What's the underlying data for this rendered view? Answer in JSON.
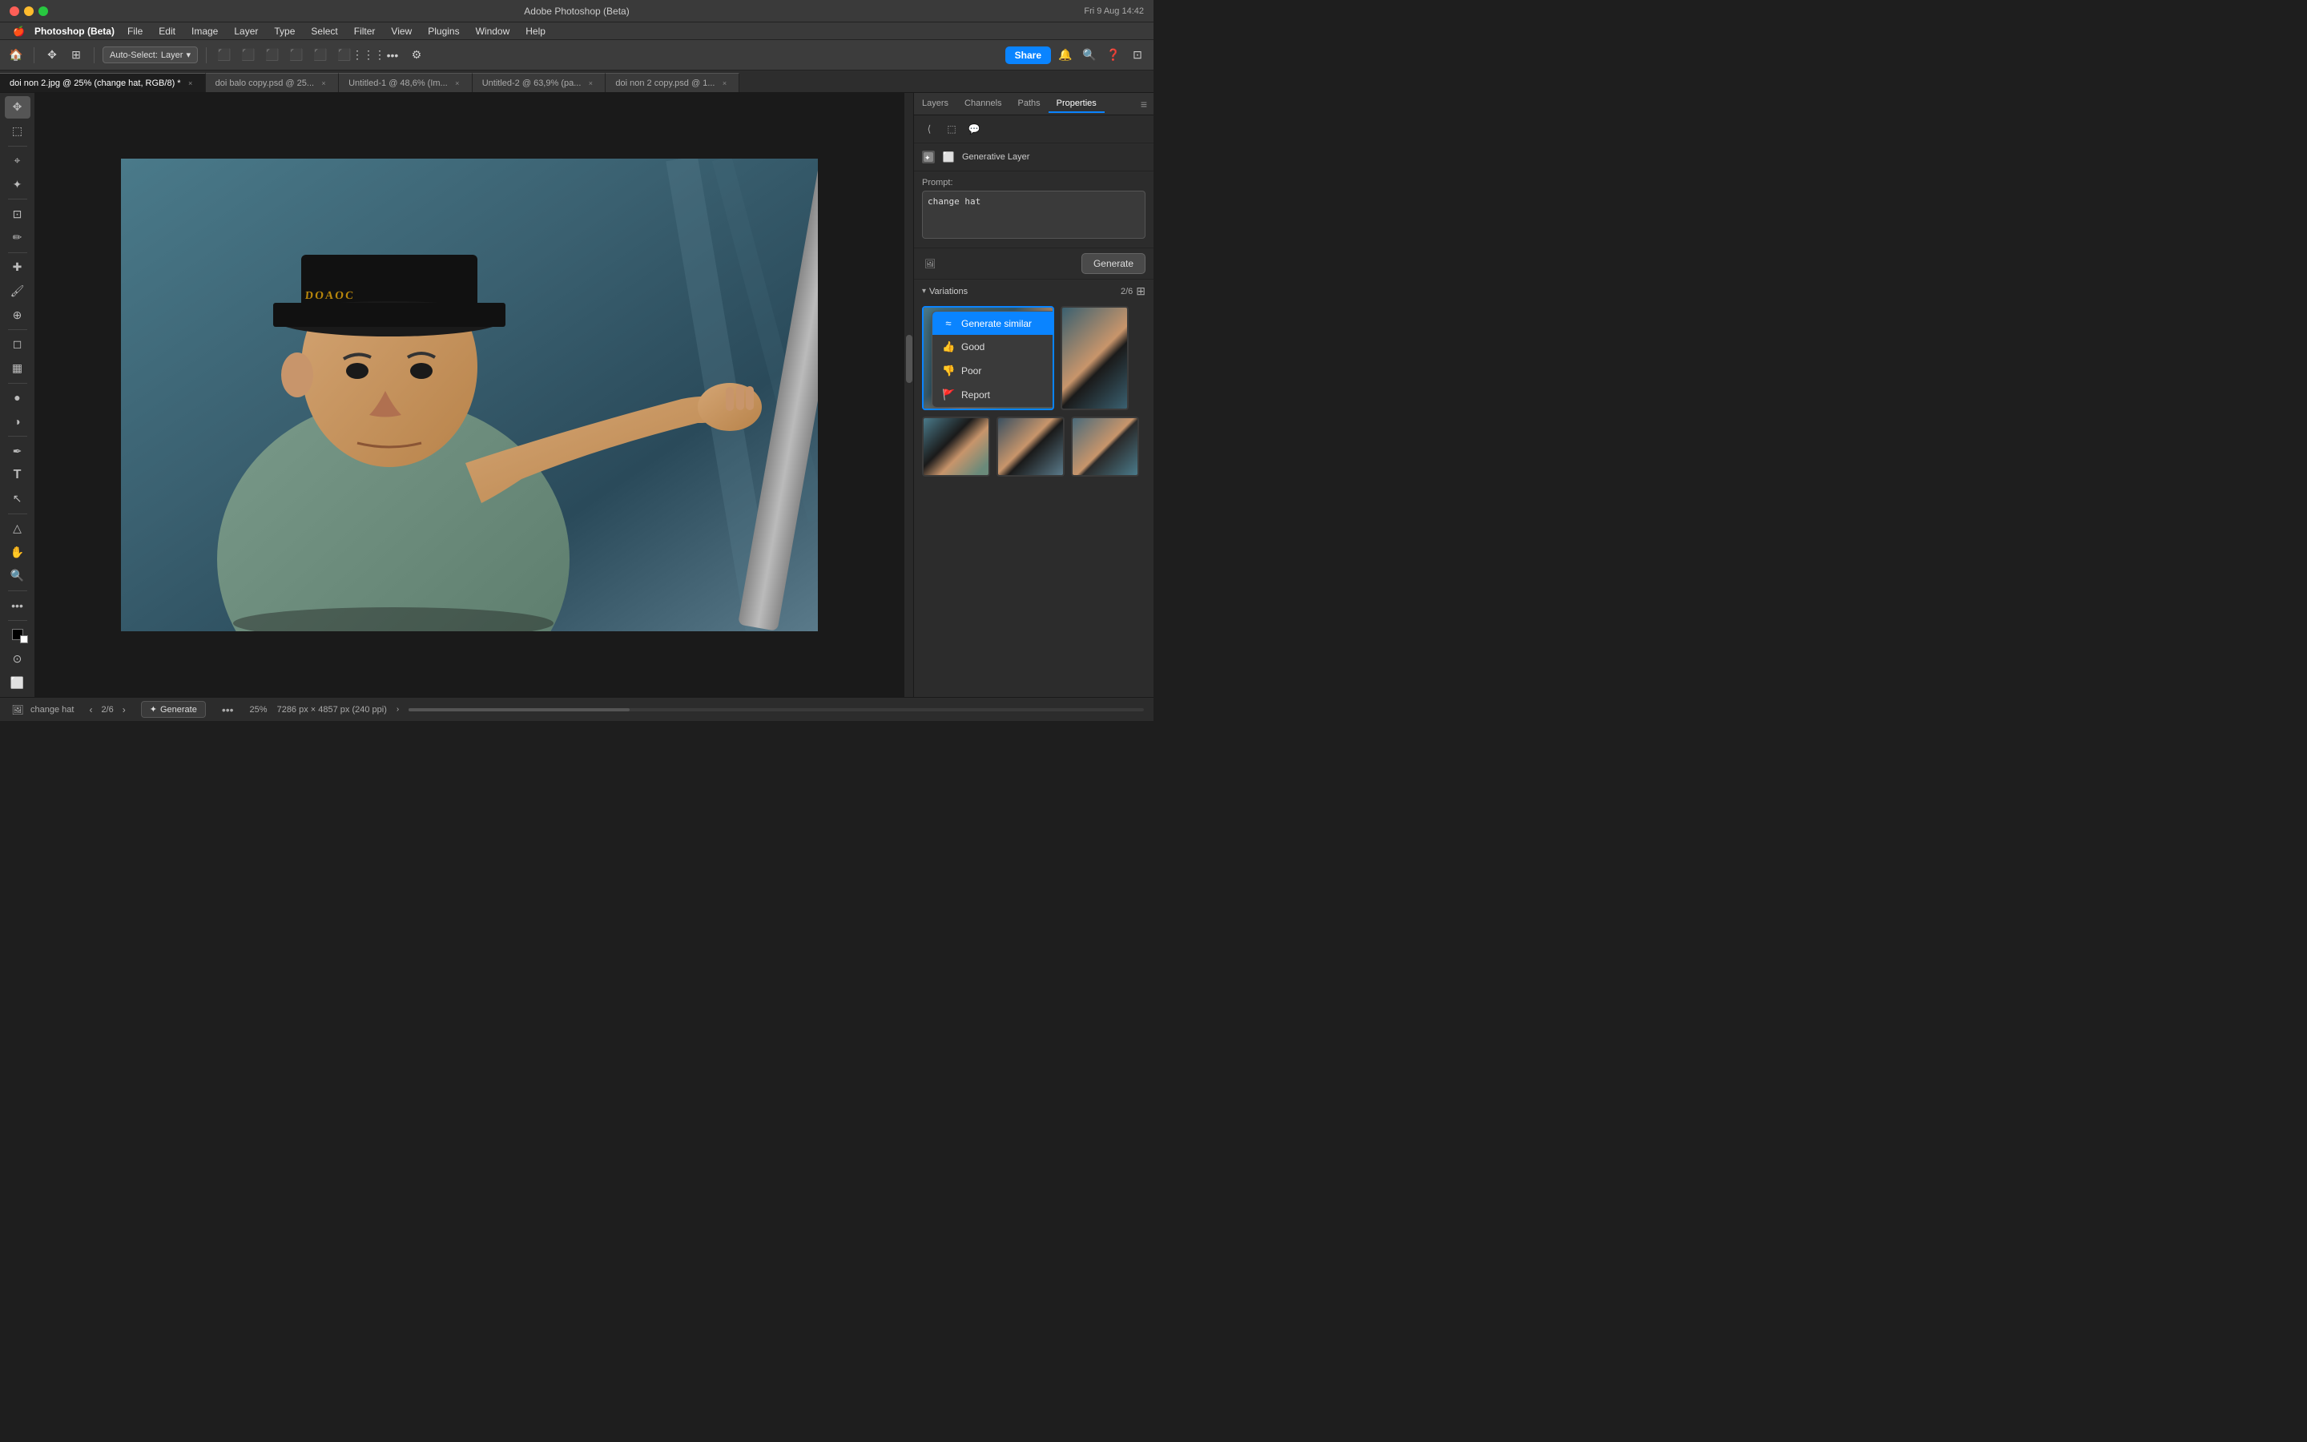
{
  "window": {
    "title": "Adobe Photoshop (Beta)",
    "app_name": "Photoshop (Beta)"
  },
  "titlebar": {
    "title": "Adobe Photoshop (Beta)",
    "time": "Fri 9 Aug  14:42"
  },
  "menubar": {
    "apple": "🍎",
    "app": "Photoshop (Beta)",
    "items": [
      "File",
      "Edit",
      "Image",
      "Layer",
      "Type",
      "Select",
      "Filter",
      "View",
      "Plugins",
      "Window",
      "Help"
    ]
  },
  "toolbar": {
    "auto_select_label": "Auto-Select:",
    "auto_select_value": "Layer",
    "share_label": "Share"
  },
  "tabs": [
    {
      "label": "doi non 2.jpg @ 25% (change hat, RGB/8) *",
      "active": true
    },
    {
      "label": "doi balo copy.psd @ 25...",
      "active": false
    },
    {
      "label": "Untitled-1 @ 48,6% (Im...",
      "active": false
    },
    {
      "label": "Untitled-2 @ 63,9% (pa...",
      "active": false
    },
    {
      "label": "doi non 2 copy.psd @ 1...",
      "active": false
    }
  ],
  "right_panel": {
    "tabs": [
      "Layers",
      "Channels",
      "Paths",
      "Properties"
    ],
    "active_tab": "Properties",
    "generative_layer_label": "Generative Layer",
    "prompt_label": "Prompt:",
    "prompt_value": "change hat",
    "generate_label": "Generate",
    "variations_label": "Variations",
    "variations_count": "2/6",
    "thumbnails": [
      {
        "id": 1,
        "selected": true,
        "class": "thumb-photo-1"
      },
      {
        "id": 2,
        "selected": false,
        "class": "thumb-photo-2"
      },
      {
        "id": 3,
        "selected": false,
        "class": "thumb-photo-3"
      },
      {
        "id": 4,
        "selected": false,
        "class": "thumb-photo-4"
      },
      {
        "id": 5,
        "selected": false,
        "class": "thumb-photo-5"
      }
    ]
  },
  "context_menu": {
    "items": [
      {
        "id": "generate_similar",
        "label": "Generate similar",
        "icon": "≈",
        "highlighted": true
      },
      {
        "id": "good",
        "label": "Good",
        "icon": "👍",
        "highlighted": false
      },
      {
        "id": "poor",
        "label": "Poor",
        "icon": "👎",
        "highlighted": false
      },
      {
        "id": "report",
        "label": "Report",
        "icon": "🚩",
        "highlighted": false
      }
    ]
  },
  "status_bar": {
    "prompt_text": "change hat",
    "navigation": "2/6",
    "generate_label": "Generate",
    "zoom": "25%",
    "size": "7286 px × 4857 px (240 ppi)"
  },
  "left_tools": [
    {
      "name": "move-tool",
      "icon": "✥"
    },
    {
      "name": "rectangular-marquee-tool",
      "icon": "⬚"
    },
    {
      "name": "lasso-tool",
      "icon": "⌖"
    },
    {
      "name": "magic-wand-tool",
      "icon": "🪄"
    },
    {
      "name": "crop-tool",
      "icon": "⊡"
    },
    {
      "name": "eyedropper-tool",
      "icon": "💧"
    },
    {
      "name": "healing-brush-tool",
      "icon": "✚"
    },
    {
      "name": "brush-tool",
      "icon": "🖌"
    },
    {
      "name": "clone-stamp-tool",
      "icon": "🔍"
    },
    {
      "name": "eraser-tool",
      "icon": "◻"
    },
    {
      "name": "gradient-tool",
      "icon": "▦"
    },
    {
      "name": "blur-tool",
      "icon": "●"
    },
    {
      "name": "dodge-tool",
      "icon": "◑"
    },
    {
      "name": "pen-tool",
      "icon": "✒"
    },
    {
      "name": "type-tool",
      "icon": "T"
    },
    {
      "name": "path-selection-tool",
      "icon": "↖"
    },
    {
      "name": "shape-tool",
      "icon": "△"
    },
    {
      "name": "hand-tool",
      "icon": "✋"
    },
    {
      "name": "zoom-tool",
      "icon": "🔍"
    }
  ]
}
